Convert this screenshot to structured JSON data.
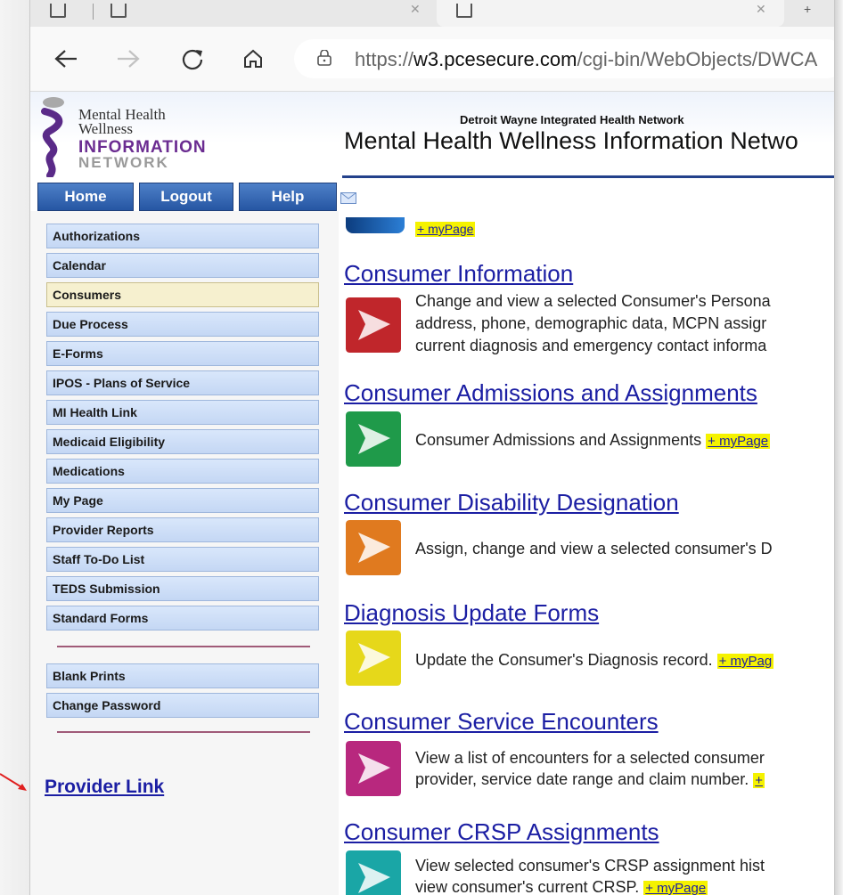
{
  "browser": {
    "url_prefix": "https://",
    "url_host": "w3.pcesecure.com",
    "url_path": "/cgi-bin/WebObjects/DWCA"
  },
  "header": {
    "logo_line1": "Mental Health",
    "logo_line2": "Wellness",
    "logo_line3": "INFORMATION",
    "logo_line4": "NETWORK",
    "org_name": "Detroit Wayne Integrated Health Network",
    "title": "Mental Health Wellness Information Netwo"
  },
  "topnav": {
    "home": "Home",
    "logout": "Logout",
    "help": "Help"
  },
  "sidebar": {
    "items": [
      {
        "label": "Authorizations"
      },
      {
        "label": "Calendar"
      },
      {
        "label": "Consumers"
      },
      {
        "label": "Due Process"
      },
      {
        "label": "E-Forms"
      },
      {
        "label": "IPOS - Plans of Service"
      },
      {
        "label": "MI Health Link"
      },
      {
        "label": "Medicaid Eligibility"
      },
      {
        "label": "Medications"
      },
      {
        "label": "My Page"
      },
      {
        "label": "Provider Reports"
      },
      {
        "label": "Staff To-Do List"
      },
      {
        "label": "TEDS Submission"
      },
      {
        "label": "Standard Forms"
      }
    ],
    "extra_items": [
      {
        "label": "Blank Prints"
      },
      {
        "label": "Change Password"
      }
    ],
    "provider_link": "Provider Link"
  },
  "content": {
    "top_mypage": "+ myPage",
    "sections": [
      {
        "title": "Consumer Information",
        "line1": "Change and view a selected Consumer's Persona",
        "line2": "address, phone, demographic data, MCPN assigr",
        "line3": "current diagnosis and emergency contact informa",
        "color": "#c0262b"
      },
      {
        "title": "Consumer Admissions and Assignments",
        "line1": "Consumer Admissions and Assignments",
        "mypage": "+ myPage",
        "color": "#1f9a4a"
      },
      {
        "title": "Consumer Disability Designation",
        "line1": "Assign, change and view a selected consumer's D",
        "color": "#e07a1f"
      },
      {
        "title": "Diagnosis Update Forms",
        "line1": "Update the Consumer's Diagnosis record.",
        "mypage": "+ myPag",
        "color": "#e6d81a"
      },
      {
        "title": "Consumer Service Encounters",
        "line1": "View a list of encounters for a selected consumer",
        "line2": "provider, service date range and claim number.",
        "mypage": "+",
        "color": "#b8287e"
      },
      {
        "title": "Consumer CRSP Assignments",
        "line1": "View selected consumer's CRSP assignment hist",
        "line2": "view consumer's current CRSP.",
        "mypage": "+ myPage",
        "color": "#1aa6a6"
      }
    ]
  }
}
